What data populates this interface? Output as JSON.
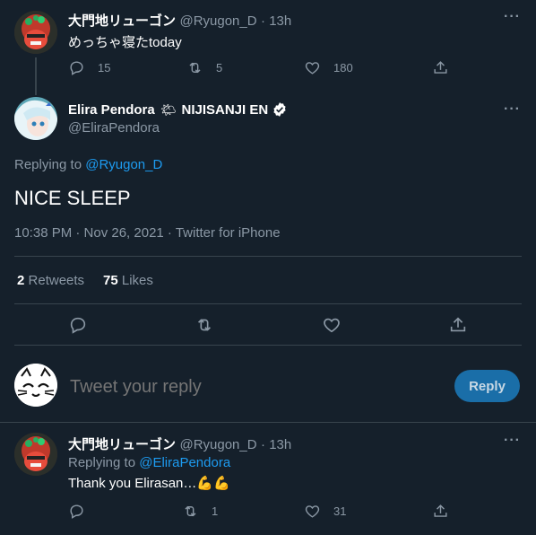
{
  "tweet1": {
    "author_name": "大門地リューゴン",
    "author_handle": "@Ryugon_D",
    "time": "· 13h",
    "text": "めっちゃ寝たtoday",
    "replies": "15",
    "retweets": "5",
    "likes": "180"
  },
  "main": {
    "author_name": "Elira Pendora",
    "author_tag": "NIJISANJI EN",
    "author_handle": "@EliraPendora",
    "replying_label": "Replying to",
    "replying_to": "@Ryugon_D",
    "text": "NICE SLEEP",
    "meta": "10:38 PM · Nov 26, 2021 · Twitter for iPhone",
    "retweets_count": "2",
    "retweets_label": "Retweets",
    "likes_count": "75",
    "likes_label": "Likes"
  },
  "compose": {
    "placeholder": "Tweet your reply",
    "reply_button": "Reply"
  },
  "tweet3": {
    "author_name": "大門地リューゴン",
    "author_handle": "@Ryugon_D",
    "time": "· 13h",
    "replying_label": "Replying to",
    "replying_to": "@EliraPendora",
    "text": "Thank you Elirasan…",
    "emoji": "💪💪",
    "retweets": "1",
    "likes": "31"
  },
  "colors": {
    "background": "#15202b",
    "accent": "#1d9bf0",
    "muted": "#8b98a5",
    "reply_button": "#1a6ea8"
  }
}
